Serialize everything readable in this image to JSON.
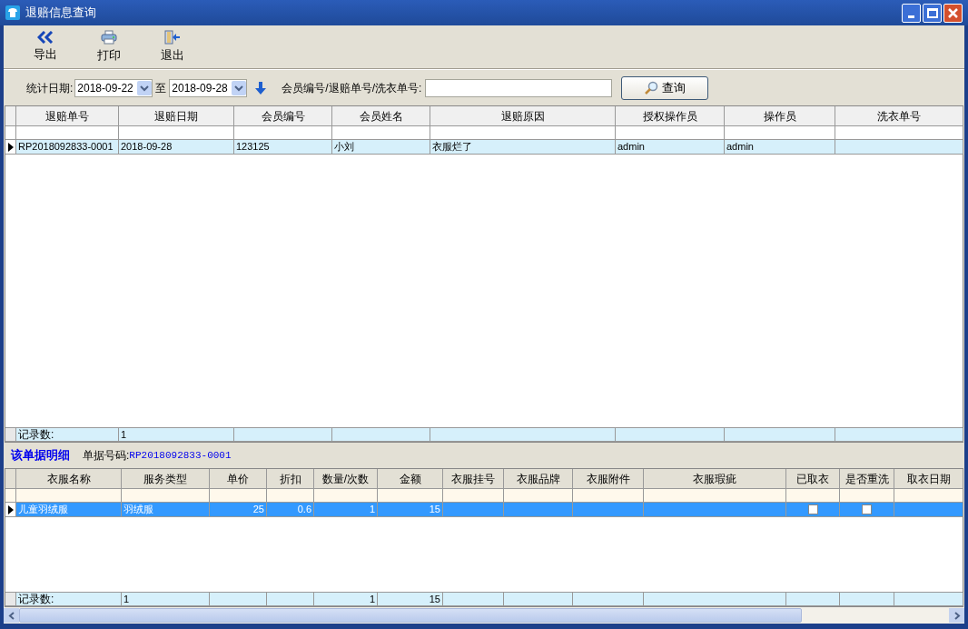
{
  "window": {
    "title": "退赔信息查询"
  },
  "toolbar": [
    {
      "label": "导出",
      "kind": "export"
    },
    {
      "label": "打印",
      "kind": "print"
    },
    {
      "label": "退出",
      "kind": "exit"
    }
  ],
  "filter": {
    "date_label": "统计日期:",
    "date_from": "2018-09-22",
    "to_label": "至",
    "date_to": "2018-09-28",
    "search_label": "会员编号/退赔单号/洗衣单号:",
    "query_button": "查询"
  },
  "refunds_table": {
    "columns": [
      "退赔单号",
      "退赔日期",
      "会员编号",
      "会员姓名",
      "退赔原因",
      "授权操作员",
      "操作员",
      "洗衣单号"
    ],
    "rows": [
      {
        "selected": true,
        "cells": [
          {
            "kind": "text",
            "text": "RP2018092833-0001"
          },
          {
            "kind": "text",
            "text": "2018-09-28"
          },
          {
            "kind": "text",
            "text": "123125"
          },
          {
            "kind": "text",
            "text": "小刘"
          },
          {
            "kind": "text",
            "text": "衣服烂了"
          },
          {
            "kind": "text",
            "text": "admin"
          },
          {
            "kind": "text",
            "text": "admin"
          },
          {
            "kind": "text"
          }
        ]
      }
    ],
    "footer": [
      {
        "kind": "text",
        "text": "记录数:"
      },
      {
        "kind": "text",
        "text": "1"
      },
      {
        "kind": "text"
      },
      {
        "kind": "text"
      },
      {
        "kind": "text"
      },
      {
        "kind": "text"
      },
      {
        "kind": "text"
      },
      {
        "kind": "text"
      }
    ]
  },
  "detail_header": {
    "title": "该单据明细",
    "number_label": "单据号码:",
    "number": "RP2018092833-0001"
  },
  "detail_table": {
    "columns": [
      "衣服名称",
      "服务类型",
      "单价",
      "折扣",
      "数量/次数",
      "金额",
      "衣服挂号",
      "衣服品牌",
      "衣服附件",
      "衣服瑕疵",
      "已取衣",
      "是否重洗",
      "取衣日期"
    ],
    "rows": [
      {
        "selected": true,
        "cells": [
          {
            "kind": "text",
            "text": "儿童羽绒服"
          },
          {
            "kind": "text",
            "text": "羽绒服"
          },
          {
            "kind": "text",
            "text": "25"
          },
          {
            "kind": "text",
            "text": "0.6"
          },
          {
            "kind": "text",
            "text": "1"
          },
          {
            "kind": "text",
            "text": "15"
          },
          {
            "kind": "text"
          },
          {
            "kind": "text"
          },
          {
            "kind": "text"
          },
          {
            "kind": "text"
          },
          {
            "kind": "checkbox",
            "checked": false
          },
          {
            "kind": "checkbox",
            "checked": false
          },
          {
            "kind": "text"
          }
        ]
      }
    ],
    "footer": [
      {
        "kind": "text",
        "text": "记录数:"
      },
      {
        "kind": "text",
        "text": "1"
      },
      {
        "kind": "text"
      },
      {
        "kind": "text"
      },
      {
        "kind": "text",
        "text": "1"
      },
      {
        "kind": "text",
        "text": "15"
      },
      {
        "kind": "text"
      },
      {
        "kind": "text"
      },
      {
        "kind": "text"
      },
      {
        "kind": "text"
      },
      {
        "kind": "text"
      },
      {
        "kind": "text"
      },
      {
        "kind": "text"
      }
    ]
  }
}
